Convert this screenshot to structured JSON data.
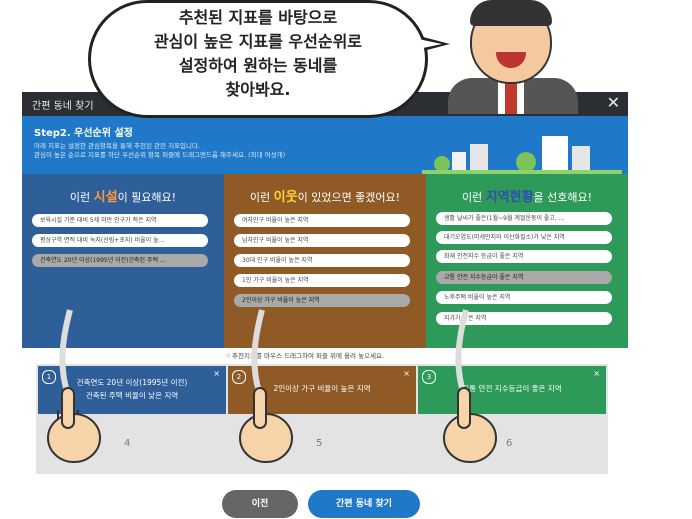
{
  "speech_bubble": {
    "lines": [
      "추천된 지표를 바탕으로",
      "관심이 높은 지표를 우선순위로",
      "설정하여 원하는 동네를",
      "찾아봐요."
    ]
  },
  "dialog": {
    "title": "간편 동네 찾기",
    "close_icon": "✕",
    "step_title": "Step2. 우선순위 설정",
    "step_desc_1": "아래 지표는 설정한 관심항목을 통해 추천된 관련 지표입니다.",
    "step_desc_2": "관심이 높은 순으로 지표를 하단 우선순위 항목 퍼즐에 드래그앤드롭 해주세요. (최대 여섯개)"
  },
  "panels": [
    {
      "header_pre": "이런 ",
      "header_highlight": "시설",
      "header_post": "이 필요해요!",
      "items": [
        "보육시설 기준 대비 5세 미만 인구가 적은 지역",
        "평상구역 면적 대비 녹지(산림+초지) 비율이 높...",
        "건축연도 20년 이상(1995년 이전)건축된 주택 ..."
      ]
    },
    {
      "header_pre": "이런 ",
      "header_highlight": "이웃",
      "header_post": "이 있었으면 좋겠어요!",
      "items": [
        "여자인구 비율이 높은 지역",
        "남자인구 비율이 높은 지역",
        "30대 인구 비율이 높은 지역",
        "1인 가구 비율이 높은 지역",
        "2인이상 가구 비율이 높은 지역"
      ]
    },
    {
      "header_pre": "이런 ",
      "header_highlight": "지역현황",
      "header_post": "을 선호해요!",
      "items": [
        "생활 날씨가 좋은(1월~9월 계절운동이 좋고, ...",
        "대기오염도(미세먼지와 이산화질소)가 낮은 지역",
        "화재 안전지수 등급이 좋은 지역",
        "교통 안전 지수등급이 좋은 지역",
        "노후주택 비율이 높은 지역",
        "지가가 낮은 지역"
      ]
    }
  ],
  "hint": "추천지표를 마우스 드래그하여 퍼즐 위에 올려 놓으세요.",
  "slots": [
    {
      "num": "1",
      "line1": "건축연도 20년 이상(1995년 이전)",
      "line2": "건축된 주택 비율이 낮은 지역",
      "below": "4"
    },
    {
      "num": "2",
      "line1": "2인이상 가구 비율이 높은 지역",
      "line2": "",
      "below": "5"
    },
    {
      "num": "3",
      "line1": "교통 안전 지수등급이 좋은 지역",
      "line2": "",
      "below": "6"
    }
  ],
  "slot_close": "×",
  "buttons": {
    "prev": "이전",
    "find": "간편 동네 찾기"
  }
}
